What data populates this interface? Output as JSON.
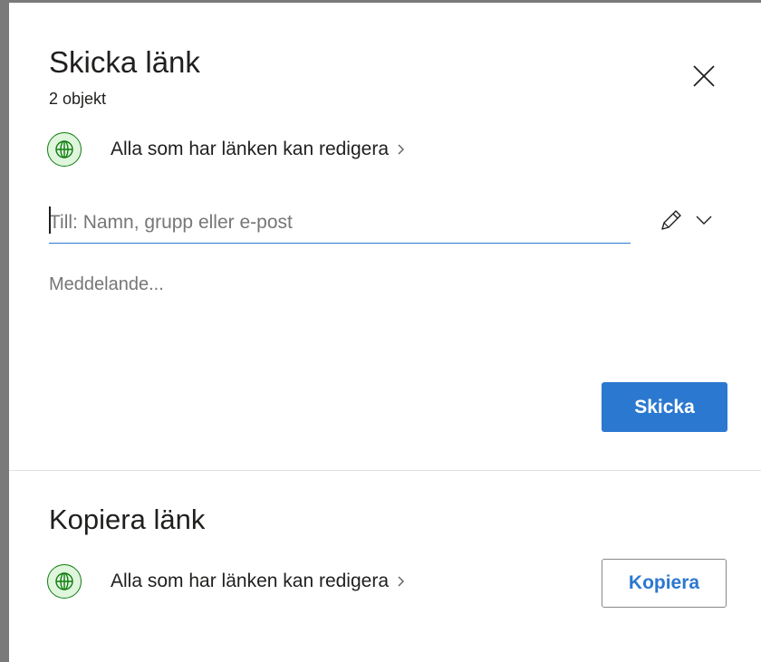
{
  "send_link": {
    "title": "Skicka länk",
    "item_count": "2 objekt",
    "link_setting": "Alla som har länken kan redigera",
    "to_placeholder": "Till: Namn, grupp eller e-post",
    "message_placeholder": "Meddelande...",
    "send_label": "Skicka"
  },
  "copy_link": {
    "title": "Kopiera länk",
    "link_setting": "Alla som har länken kan redigera",
    "copy_label": "Kopiera"
  },
  "icons": {
    "close": "close-icon",
    "globe": "globe-icon",
    "chevron_right": "chevron-right-icon",
    "pencil": "pencil-icon",
    "chevron_down": "chevron-down-icon"
  },
  "colors": {
    "accent": "#2b78d0",
    "globe_bg": "#dff6dd",
    "globe_stroke": "#107c10"
  }
}
